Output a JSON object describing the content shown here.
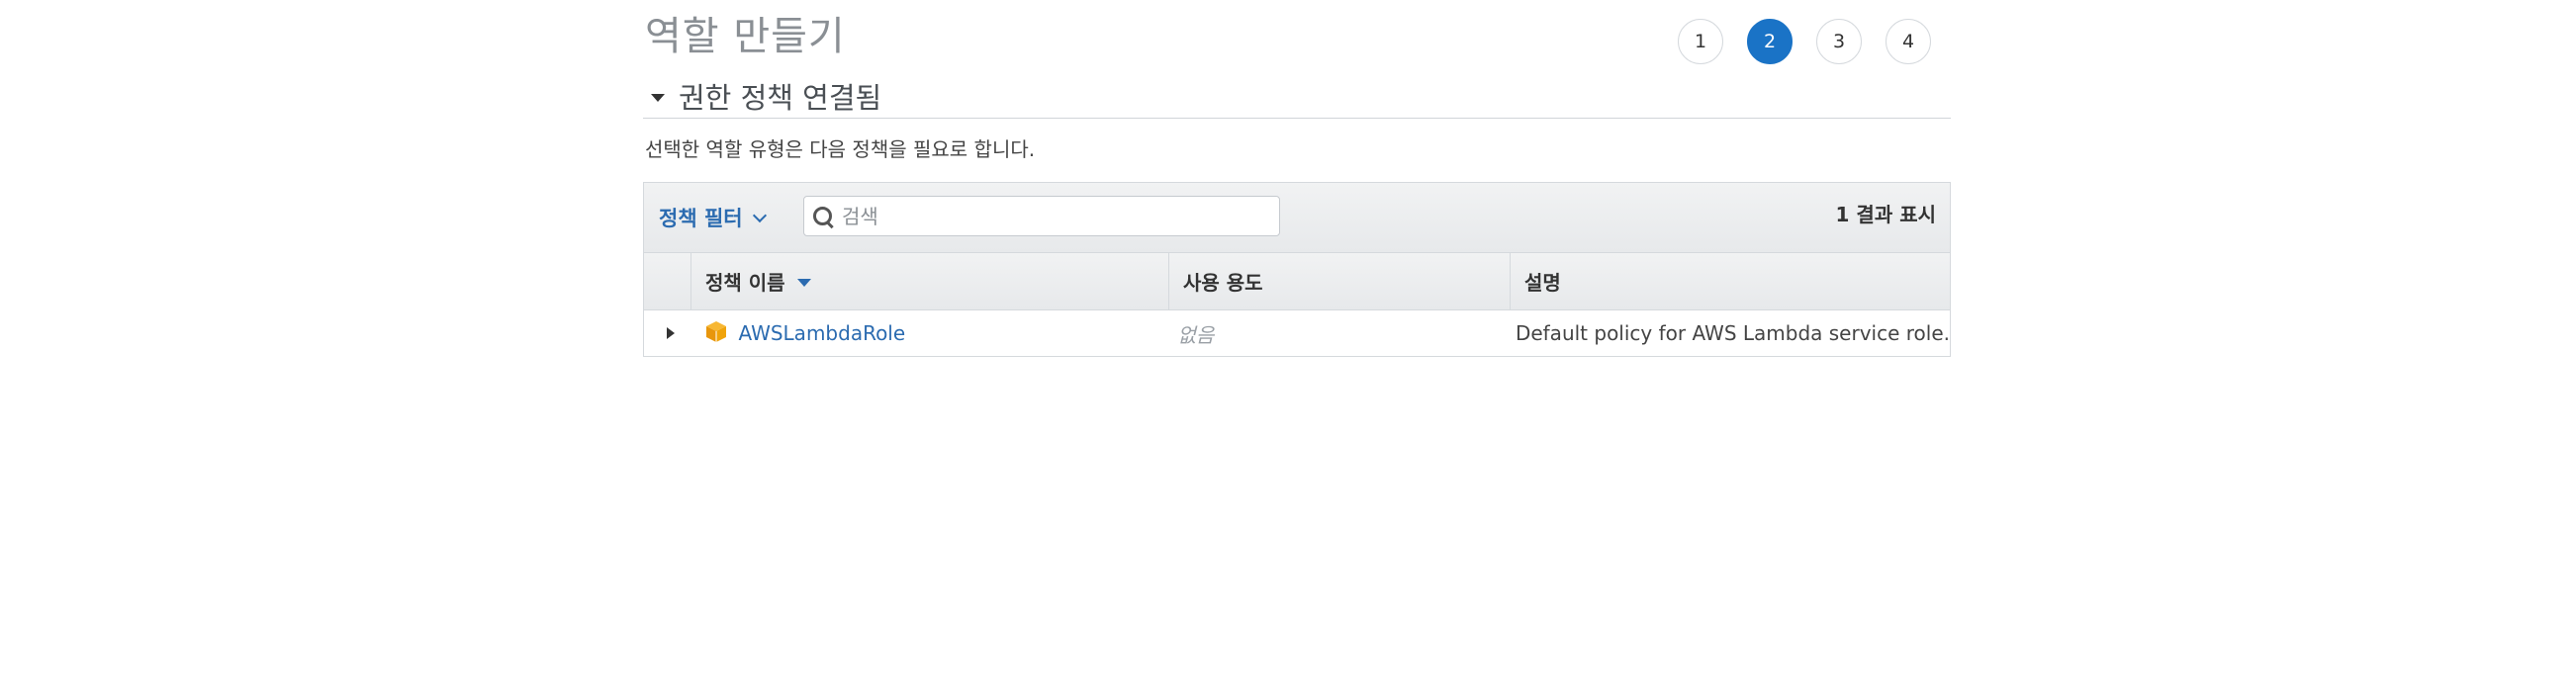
{
  "page": {
    "title": "역할 만들기"
  },
  "steps": [
    {
      "label": "1",
      "active": false
    },
    {
      "label": "2",
      "active": true
    },
    {
      "label": "3",
      "active": false
    },
    {
      "label": "4",
      "active": false
    }
  ],
  "section": {
    "title": "권한 정책 연결됨",
    "description": "선택한 역할 유형은 다음 정책을 필요로 합니다."
  },
  "toolbar": {
    "filter_label": "정책 필터",
    "search_placeholder": "검색",
    "search_value": "",
    "result_count": "1 결과 표시"
  },
  "table": {
    "columns": [
      "정책 이름",
      "사용 용도",
      "설명"
    ],
    "sorted_column": "정책 이름",
    "rows": [
      {
        "name": "AWSLambdaRole",
        "usage": "없음",
        "description": "Default policy for AWS Lambda service role.",
        "icon": "aws-policy-cube-icon"
      }
    ]
  },
  "colors": {
    "accent": "#1a73c6",
    "link": "#2b6bb0",
    "policy_icon": "#f0a30a"
  }
}
